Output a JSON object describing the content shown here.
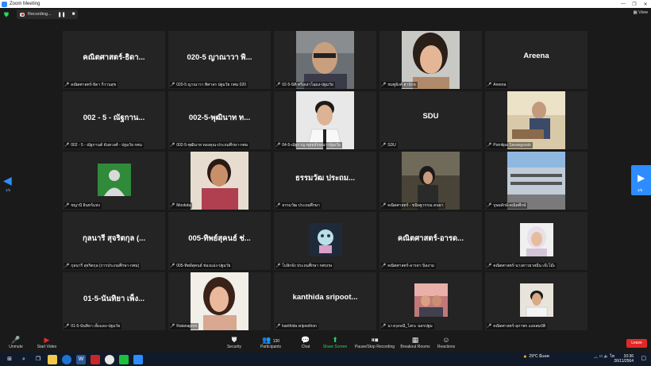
{
  "window": {
    "title": "Zoom Meeting"
  },
  "topbar": {
    "recording_label": "Recording...",
    "pause": "❚❚",
    "stop": "■",
    "view_label": "View"
  },
  "nav": {
    "left_page": "4/5",
    "right_page": "4/5"
  },
  "tiles": [
    {
      "text": "คณิตศาสตร์-ธิดา...",
      "label": "คณิตศาสตร์-ธิดา กิ่วานสุข"
    },
    {
      "text": "020-5 ญาณาวา พิ...",
      "label": "020-5 ญาณาวา พิศาลร ปฐมวัย กศม 020"
    },
    {
      "text": "",
      "label": "02-5-นิติ ศรีเผล่าโฉมง-ปฐมวัย"
    },
    {
      "text": "",
      "label": "ชมพูอิงค์ ฮานักจ"
    },
    {
      "text": "Areena",
      "label": "Areena"
    },
    {
      "text": "002 - 5 - ณัฐกาน...",
      "label": "002 - 5 - ณัฐกานต์ จันทวงศ์ - ปฐมวัย กศม"
    },
    {
      "text": "002-5-พุฒินาท ท...",
      "label": "002-5-พุฒินาท ทองคุณ-ประถมศึกษา-กศม"
    },
    {
      "text": "",
      "label": "04-5-ณัฐกาญ พุทธลักษณา-ปฐมวัย"
    },
    {
      "text": "SDU",
      "label": "SDU"
    },
    {
      "text": "",
      "label": "Porntipa Savangsook"
    },
    {
      "text": "",
      "label": "ชญานี อินทร์แหง"
    },
    {
      "text": "",
      "label": "Mookda"
    },
    {
      "text": "ธรรมวัฒ ประถม...",
      "label": "ธรรมวัฒ ประถมศึกษา"
    },
    {
      "text": "",
      "label": "คณิตศาสตร์ - ขนิษฐวรรณ คนธา"
    },
    {
      "text": "",
      "label": "บุษผลักษ์-คณิตศึกษ์"
    },
    {
      "text": "กุลนารี สุจริตกุล (...",
      "label": "กุลนารี สุจริตกุล (การประถมศึกษา-กศม)"
    },
    {
      "text": "005-ทิพย์สุคนธ์ ช่...",
      "label": "005-ทิพย์สุคนธ์ ช่องแม่ง-ปฐมวัย"
    },
    {
      "text": "",
      "label": "โบลิกจัง ประถมศึกษา กศบกษ"
    },
    {
      "text": "คณิตศาสตร์-อารด...",
      "label": "คณิตศาสตร์-อารดา นิลงาม"
    },
    {
      "text": "",
      "label": "คณิตศาสตร์-นางสาวยาสมีน เจ๊ะโม๊ะ"
    },
    {
      "text": "01-5-นันทิยา เพ็ง...",
      "label": "01-5-นันทิยา เพ็งแดง-ปฐมวัย"
    },
    {
      "text": "",
      "label": "Ratanaporn"
    },
    {
      "text": "kanthida sripoot...",
      "label": "kanthida sripoothon"
    },
    {
      "text": "",
      "label": "นางกุลจณี_ไสกะ นครปฐม"
    },
    {
      "text": "",
      "label": "คณิตศาสตร์-สุภาพร แสงสมบัติ"
    }
  ],
  "toolbar": {
    "unmute": "Unmute",
    "start_video": "Start Video",
    "security": "Security",
    "participants": "Participants",
    "participants_count": "130",
    "chat": "Chat",
    "share_screen": "Share Screen",
    "recording": "Pause/Stop Recording",
    "breakout": "Breakout Rooms",
    "reactions": "Reactions",
    "leave": "Leave"
  },
  "taskbar": {
    "weather": "29°C",
    "weather_desc": "มีแดด",
    "time": "10:36",
    "date": "26/11/2564"
  },
  "colors": {
    "accent": "#2d8cff",
    "danger": "#e02828",
    "green": "#23d959"
  }
}
